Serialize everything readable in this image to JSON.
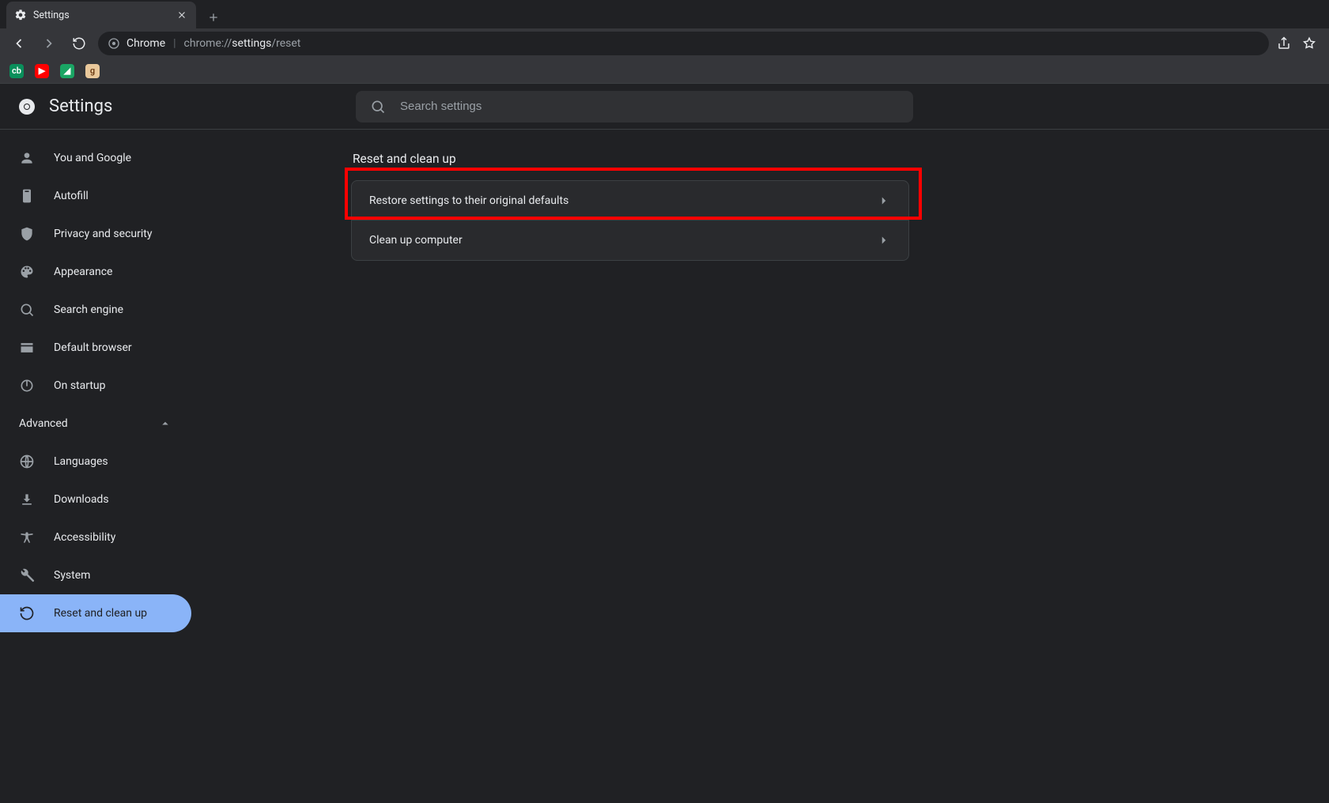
{
  "tab": {
    "title": "Settings"
  },
  "omnibox": {
    "scheme_label": "Chrome",
    "path_prefix": "chrome://",
    "path_mid": "settings",
    "path_suffix": "/reset"
  },
  "settings_header": {
    "title": "Settings"
  },
  "search": {
    "placeholder": "Search settings"
  },
  "sidebar": {
    "items": [
      {
        "label": "You and Google"
      },
      {
        "label": "Autofill"
      },
      {
        "label": "Privacy and security"
      },
      {
        "label": "Appearance"
      },
      {
        "label": "Search engine"
      },
      {
        "label": "Default browser"
      },
      {
        "label": "On startup"
      }
    ],
    "advanced_label": "Advanced",
    "advanced_items": [
      {
        "label": "Languages"
      },
      {
        "label": "Downloads"
      },
      {
        "label": "Accessibility"
      },
      {
        "label": "System"
      },
      {
        "label": "Reset and clean up"
      }
    ]
  },
  "main": {
    "section_title": "Reset and clean up",
    "rows": [
      {
        "label": "Restore settings to their original defaults"
      },
      {
        "label": "Clean up computer"
      }
    ]
  },
  "highlight": {
    "target_row": 0
  }
}
